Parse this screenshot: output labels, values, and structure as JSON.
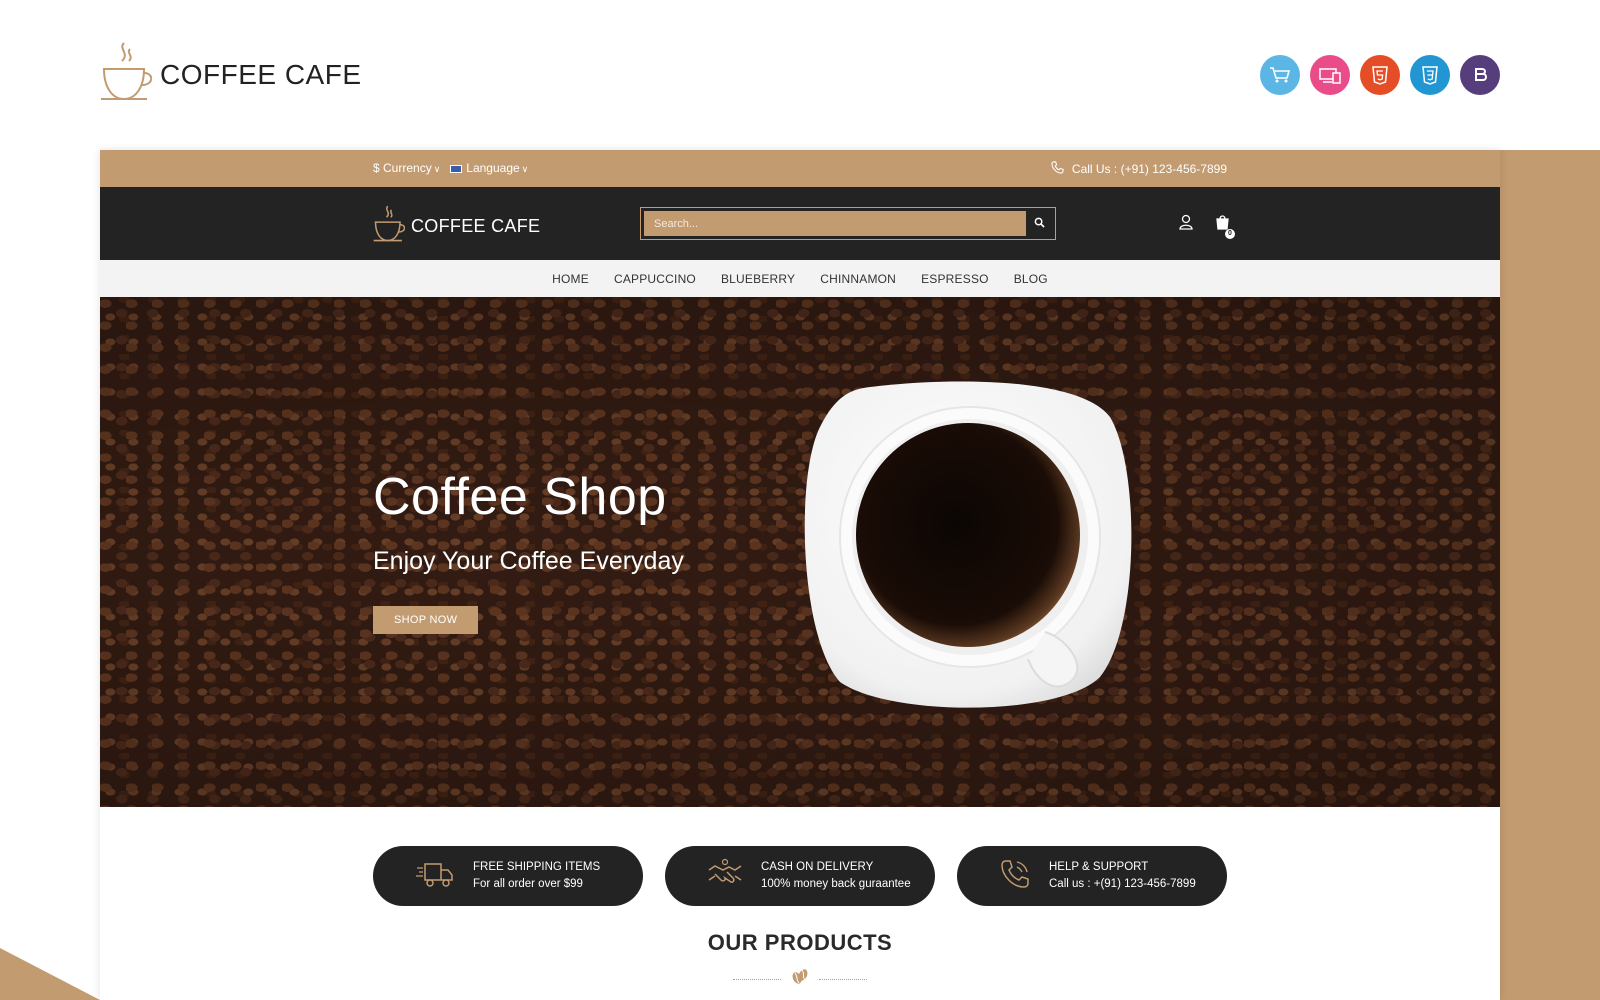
{
  "outer": {
    "brand": "COFFEE CAFE",
    "badges": [
      {
        "icon": "cart-icon",
        "color": "#5bb6e6"
      },
      {
        "icon": "responsive-icon",
        "color": "#ea4c89"
      },
      {
        "icon": "html5-icon",
        "color": "#e44d26"
      },
      {
        "icon": "css3-icon",
        "color": "#2196d3"
      },
      {
        "icon": "bootstrap-icon",
        "color": "#563d7c"
      }
    ]
  },
  "topbar": {
    "currency": "$ Currency",
    "language": "Language",
    "call": "Call Us : (+91) 123-456-7899"
  },
  "header": {
    "brand": "COFFEE CAFE",
    "search_placeholder": "Search...",
    "cart_count": "0"
  },
  "nav": [
    "HOME",
    "CAPPUCCINO",
    "BLUEBERRY",
    "CHINNAMON",
    "ESPRESSO",
    "BLOG"
  ],
  "hero": {
    "title": "Coffee Shop",
    "subtitle": "Enjoy Your Coffee Everyday",
    "button": "SHOP NOW"
  },
  "features": [
    {
      "icon": "truck-icon",
      "title": "FREE SHIPPING ITEMS",
      "text": "For all order over $99"
    },
    {
      "icon": "handshake-icon",
      "title": "CASH ON DELIVERY",
      "text": "100% money back guraantee"
    },
    {
      "icon": "phone-icon",
      "title": "HELP & SUPPORT",
      "text": "Call us : +(91) 123-456-7899"
    }
  ],
  "products": {
    "title": "OUR PRODUCTS"
  },
  "colors": {
    "accent": "#c29b70",
    "dark": "#232323"
  }
}
